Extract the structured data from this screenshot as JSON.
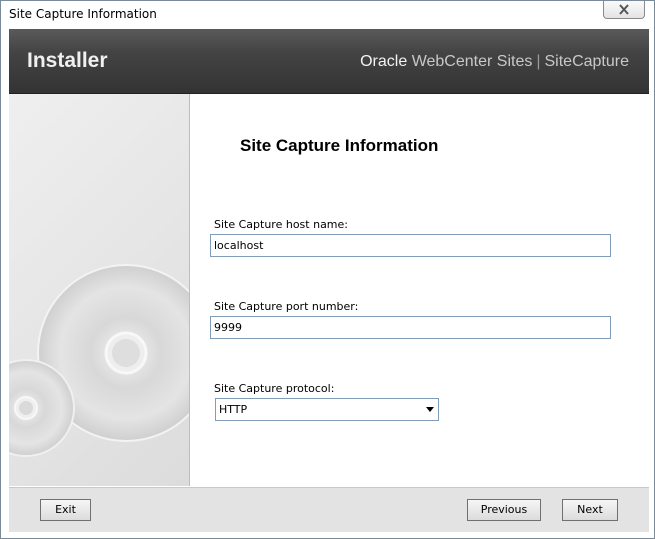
{
  "window": {
    "title": "Site Capture Information",
    "close_icon": "close-icon"
  },
  "header": {
    "brand": "Installer",
    "product_oracle": "Oracle",
    "product_name": "WebCenter Sites",
    "product_separator": "|",
    "product_module": "SiteCapture"
  },
  "side_panel": {
    "decoration": "disc-graphic"
  },
  "main": {
    "title": "Site Capture Information",
    "host": {
      "label": "Site Capture host name:",
      "value": "localhost"
    },
    "port": {
      "label": "Site Capture port number:",
      "value": "9999"
    },
    "protocol": {
      "label": "Site Capture protocol:",
      "selected": "HTTP"
    }
  },
  "footer": {
    "exit_label": "Exit",
    "previous_label": "Previous",
    "next_label": "Next"
  }
}
